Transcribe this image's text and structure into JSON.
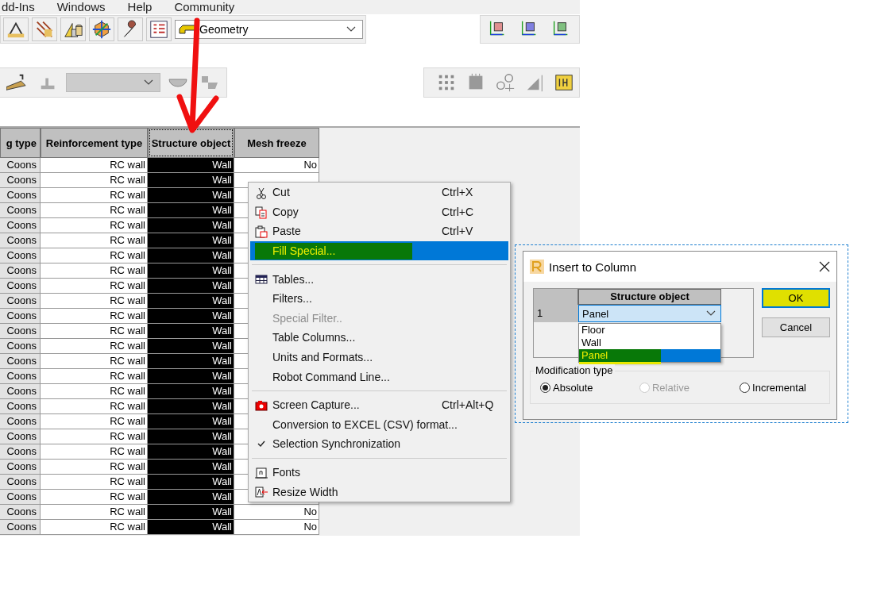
{
  "menu_bar": [
    "dd-Ins",
    "Windows",
    "Help",
    "Community"
  ],
  "toolbar": {
    "view_combo": "Geometry",
    "second_combo": {
      "disabled": true
    }
  },
  "table": {
    "columns": [
      {
        "label": "g type",
        "selected": false
      },
      {
        "label": "Reinforcement type",
        "selected": false
      },
      {
        "label": "Structure object",
        "selected": true
      },
      {
        "label": "Mesh freeze",
        "selected": false
      }
    ],
    "rows": [
      {
        "cells": [
          "Coons",
          "RC wall",
          "Wall",
          "No"
        ]
      },
      {
        "cells": [
          "Coons",
          "RC wall",
          "Wall"
        ]
      },
      {
        "cells": [
          "Coons",
          "RC wall",
          "Wall"
        ]
      },
      {
        "cells": [
          "Coons",
          "RC wall",
          "Wall"
        ]
      },
      {
        "cells": [
          "Coons",
          "RC wall",
          "Wall"
        ]
      },
      {
        "cells": [
          "Coons",
          "RC wall",
          "Wall"
        ]
      },
      {
        "cells": [
          "Coons",
          "RC wall",
          "Wall"
        ]
      },
      {
        "cells": [
          "Coons",
          "RC wall",
          "Wall"
        ]
      },
      {
        "cells": [
          "Coons",
          "RC wall",
          "Wall"
        ]
      },
      {
        "cells": [
          "Coons",
          "RC wall",
          "Wall"
        ]
      },
      {
        "cells": [
          "Coons",
          "RC wall",
          "Wall"
        ]
      },
      {
        "cells": [
          "Coons",
          "RC wall",
          "Wall"
        ]
      },
      {
        "cells": [
          "Coons",
          "RC wall",
          "Wall"
        ]
      },
      {
        "cells": [
          "Coons",
          "RC wall",
          "Wall"
        ]
      },
      {
        "cells": [
          "Coons",
          "RC wall",
          "Wall"
        ]
      },
      {
        "cells": [
          "Coons",
          "RC wall",
          "Wall"
        ]
      },
      {
        "cells": [
          "Coons",
          "RC wall",
          "Wall"
        ]
      },
      {
        "cells": [
          "Coons",
          "RC wall",
          "Wall"
        ]
      },
      {
        "cells": [
          "Coons",
          "RC wall",
          "Wall"
        ]
      },
      {
        "cells": [
          "Coons",
          "RC wall",
          "Wall"
        ]
      },
      {
        "cells": [
          "Coons",
          "RC wall",
          "Wall"
        ]
      },
      {
        "cells": [
          "Coons",
          "RC wall",
          "Wall"
        ]
      },
      {
        "cells": [
          "Coons",
          "RC wall",
          "Wall"
        ]
      },
      {
        "cells": [
          "Coons",
          "RC wall",
          "Wall",
          "No"
        ]
      },
      {
        "cells": [
          "Coons",
          "RC wall",
          "Wall",
          "No"
        ]
      }
    ]
  },
  "context_menu": [
    {
      "kind": "item",
      "label": "Cut",
      "shortcut": "Ctrl+X",
      "disabled": false,
      "checked": false,
      "selected": false
    },
    {
      "kind": "item",
      "label": "Copy",
      "shortcut": "Ctrl+C",
      "disabled": false,
      "checked": false,
      "selected": false
    },
    {
      "kind": "item",
      "label": "Paste",
      "shortcut": "Ctrl+V",
      "disabled": false,
      "checked": false,
      "selected": false
    },
    {
      "kind": "item",
      "label": "Fill Special...",
      "disabled": false,
      "checked": false,
      "selected": true
    },
    {
      "kind": "separator"
    },
    {
      "kind": "item",
      "label": "Tables...",
      "disabled": false,
      "checked": false,
      "selected": false
    },
    {
      "kind": "item",
      "label": "Filters...",
      "disabled": false,
      "checked": false,
      "selected": false
    },
    {
      "kind": "item",
      "label": "Special Filter..",
      "disabled": true,
      "checked": false,
      "selected": false
    },
    {
      "kind": "item",
      "label": "Table Columns...",
      "disabled": false,
      "checked": false,
      "selected": false
    },
    {
      "kind": "item",
      "label": "Units and Formats...",
      "disabled": false,
      "checked": false,
      "selected": false
    },
    {
      "kind": "item",
      "label": "Robot Command Line...",
      "disabled": false,
      "checked": false,
      "selected": false
    },
    {
      "kind": "separator"
    },
    {
      "kind": "item",
      "label": "Screen Capture...",
      "shortcut": "Ctrl+Alt+Q",
      "disabled": false,
      "checked": false,
      "selected": false
    },
    {
      "kind": "item",
      "label": "Conversion to EXCEL (CSV) format...",
      "disabled": false,
      "checked": false,
      "selected": false
    },
    {
      "kind": "item",
      "label": "Selection Synchronization",
      "disabled": false,
      "checked": true,
      "selected": false
    },
    {
      "kind": "separator"
    },
    {
      "kind": "item",
      "label": "Fonts",
      "disabled": false,
      "checked": false,
      "selected": false
    },
    {
      "kind": "item",
      "label": "Resize Width",
      "disabled": false,
      "checked": false,
      "selected": false
    }
  ],
  "dialog": {
    "title": "Insert to Column",
    "grid": {
      "column": "Structure object",
      "row_number": "1",
      "value": "Panel",
      "options": [
        {
          "label": "Floor",
          "selected": false
        },
        {
          "label": "Wall",
          "selected": false
        },
        {
          "label": "Panel",
          "selected": true
        }
      ]
    },
    "buttons": [
      {
        "label": "OK",
        "default": true
      },
      {
        "label": "Cancel",
        "default": false
      }
    ],
    "modification_type": {
      "label": "Modification type",
      "options": [
        {
          "label": "Absolute",
          "selected": true,
          "disabled": false
        },
        {
          "label": "Relative",
          "selected": false,
          "disabled": true
        },
        {
          "label": "Incremental",
          "selected": false,
          "disabled": false
        }
      ]
    }
  }
}
